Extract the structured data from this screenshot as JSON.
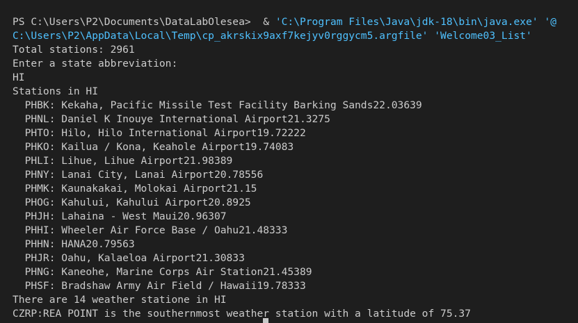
{
  "colors": {
    "background": "#1e1e1e",
    "text": "#cccccc",
    "command": "#dcdcaa",
    "string": "#4fc1ff"
  },
  "prompt": {
    "path": "PS C:\\Users\\P2\\Documents\\DataLabOlesea>",
    "operator": "&",
    "java_exe": "'C:\\Program Files\\Java\\jdk-18\\bin\\java.exe'",
    "argfile_start": "'@",
    "argfile_rest": "C:\\Users\\P2\\AppData\\Local\\Temp\\cp_akrskix9axf7kejyv0rggycm5.argfile'",
    "class_arg": "'Welcome03_List'"
  },
  "output": {
    "total": "Total stations: 2961",
    "enter": "Enter a state abbreviation:",
    "input": "HI",
    "header": "Stations in HI",
    "stations": [
      "  PHBK: Kekaha, Pacific Missile Test Facility Barking Sands22.03639",
      "  PHNL: Daniel K Inouye International Airport21.3275",
      "  PHTO: Hilo, Hilo International Airport19.72222",
      "  PHKO: Kailua / Kona, Keahole Airport19.74083",
      "  PHLI: Lihue, Lihue Airport21.98389",
      "  PHNY: Lanai City, Lanai Airport20.78556",
      "  PHMK: Kaunakakai, Molokai Airport21.15",
      "  PHOG: Kahului, Kahului Airport20.8925",
      "  PHJH: Lahaina - West Maui20.96307",
      "  PHHI: Wheeler Air Force Base / Oahu21.48333",
      "  PHHN: HANA20.79563",
      "  PHJR: Oahu, Kalaeloa Airport21.30833",
      "  PHNG: Kaneohe, Marine Corps Air Station21.45389",
      "  PHSF: Bradshaw Army Air Field / Hawaii19.78333"
    ],
    "count": "There are 14 weather statione in HI",
    "southern": "CZRP:REA POINT is the southernmost weather station with a latitude of 75.37"
  }
}
